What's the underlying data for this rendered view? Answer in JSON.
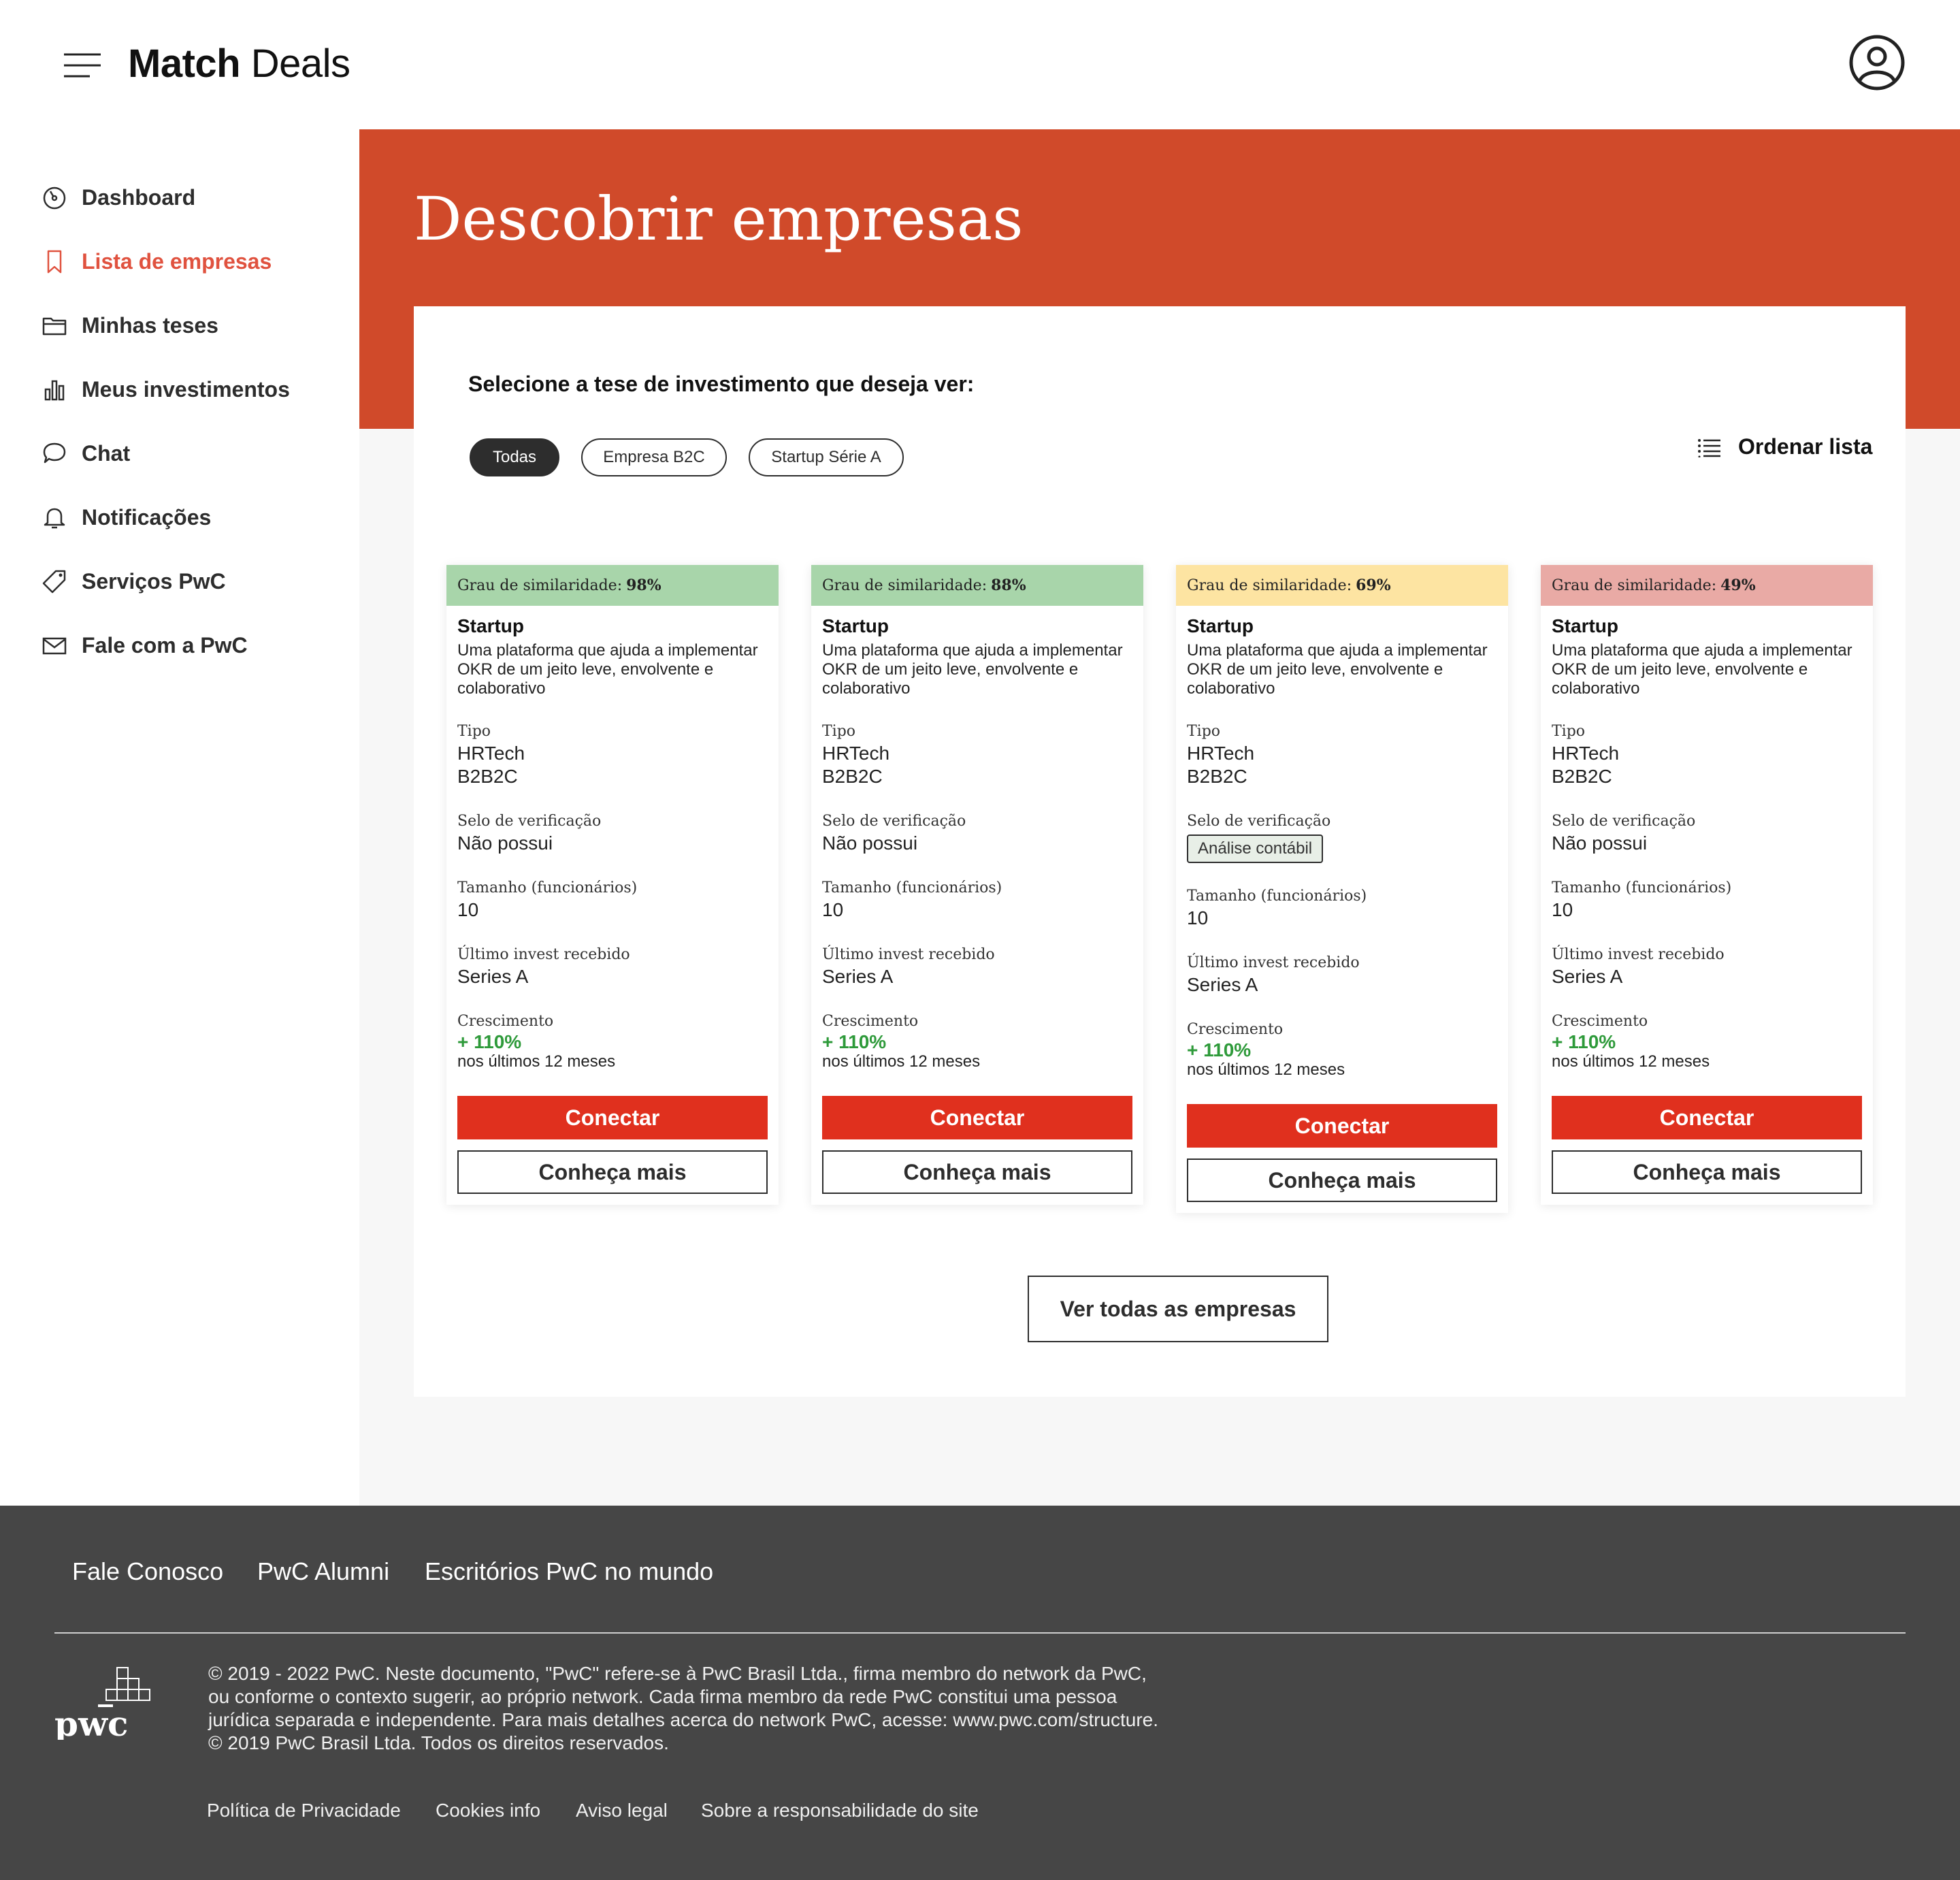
{
  "header": {
    "brand_bold": "Match",
    "brand_light": "Deals"
  },
  "sidebar": {
    "items": [
      {
        "label": "Dashboard",
        "icon": "gauge-icon",
        "active": false
      },
      {
        "label": "Lista de empresas",
        "icon": "bookmark-icon",
        "active": true
      },
      {
        "label": "Minhas teses",
        "icon": "folder-icon",
        "active": false
      },
      {
        "label": "Meus investimentos",
        "icon": "bar-chart-icon",
        "active": false
      },
      {
        "label": "Chat",
        "icon": "chat-bubble-icon",
        "active": false
      },
      {
        "label": "Notificações",
        "icon": "bell-icon",
        "active": false
      },
      {
        "label": "Serviços PwC",
        "icon": "tag-icon",
        "active": false
      },
      {
        "label": "Fale com a PwC",
        "icon": "mail-icon",
        "active": false
      }
    ]
  },
  "hero": {
    "title": "Descobrir empresas"
  },
  "panel": {
    "question": "Selecione a tese de investimento que deseja ver:",
    "filters": [
      {
        "label": "Todas",
        "selected": true
      },
      {
        "label": "Empresa B2C",
        "selected": false
      },
      {
        "label": "Startup Série A",
        "selected": false
      }
    ],
    "sort_label": "Ordenar lista",
    "see_all_label": "Ver todas as empresas"
  },
  "labels": {
    "similarity": "Grau de similaridade:",
    "tipo": "Tipo",
    "selo": "Selo de verificação",
    "tamanho": "Tamanho (funcionários)",
    "ultimo": "Último invest recebido",
    "crescimento": "Crescimento",
    "conectar": "Conectar",
    "conheca": "Conheça mais"
  },
  "colors": {
    "sim_green": "#a8d5aa",
    "sim_yellow": "#fde4a2",
    "sim_red": "#e9aaa5",
    "accent": "#d04a2a",
    "button_red": "#e0301e"
  },
  "cards": [
    {
      "similarity": "98%",
      "sim_color": "#a8d5aa",
      "title": "Startup",
      "description": "Uma plataforma que ajuda a implementar OKR de um jeito leve, envolvente e colaborativo",
      "tipo_1": "HRTech",
      "tipo_2": "B2B2C",
      "selo": "Não possui",
      "selo_badge": false,
      "tamanho": "10",
      "ultimo": "Series A",
      "growth": "+ 110%",
      "growth_sub": "nos últimos 12 meses"
    },
    {
      "similarity": "88%",
      "sim_color": "#a8d5aa",
      "title": "Startup",
      "description": "Uma plataforma que ajuda a implementar OKR de um jeito leve, envolvente e colaborativo",
      "tipo_1": "HRTech",
      "tipo_2": "B2B2C",
      "selo": "Não possui",
      "selo_badge": false,
      "tamanho": "10",
      "ultimo": "Series A",
      "growth": "+ 110%",
      "growth_sub": "nos últimos 12 meses"
    },
    {
      "similarity": "69%",
      "sim_color": "#fde4a2",
      "title": "Startup",
      "description": "Uma plataforma que ajuda a implementar OKR de um jeito leve, envolvente e colaborativo",
      "tipo_1": "HRTech",
      "tipo_2": "B2B2C",
      "selo": "Análise contábil",
      "selo_badge": true,
      "tamanho": "10",
      "ultimo": "Series A",
      "growth": "+ 110%",
      "growth_sub": "nos últimos 12 meses"
    },
    {
      "similarity": "49%",
      "sim_color": "#e9aaa5",
      "title": "Startup",
      "description": "Uma plataforma que ajuda a implementar OKR de um jeito leve, envolvente e colaborativo",
      "tipo_1": "HRTech",
      "tipo_2": "B2B2C",
      "selo": "Não possui",
      "selo_badge": false,
      "tamanho": "10",
      "ultimo": "Series A",
      "growth": "+ 110%",
      "growth_sub": "nos últimos 12 meses"
    }
  ],
  "footer": {
    "links": [
      "Fale Conosco",
      "PwC Alumni",
      "Escritórios PwC no mundo"
    ],
    "legal_lines": [
      "© 2019 - 2022 PwC. Neste documento, \"PwC\" refere-se à PwC Brasil Ltda., firma membro do network da PwC,",
      "ou conforme o contexto sugerir, ao próprio network. Cada firma membro da rede PwC constitui uma pessoa",
      "jurídica separada e independente. Para mais detalhes acerca do network PwC, acesse: www.pwc.com/structure.",
      "© 2019 PwC Brasil Ltda. Todos os direitos reservados."
    ],
    "bottom_links": [
      "Política de Privacidade",
      "Cookies info",
      "Aviso legal",
      "Sobre a responsabilidade do site"
    ],
    "logo_text": "pwc"
  }
}
